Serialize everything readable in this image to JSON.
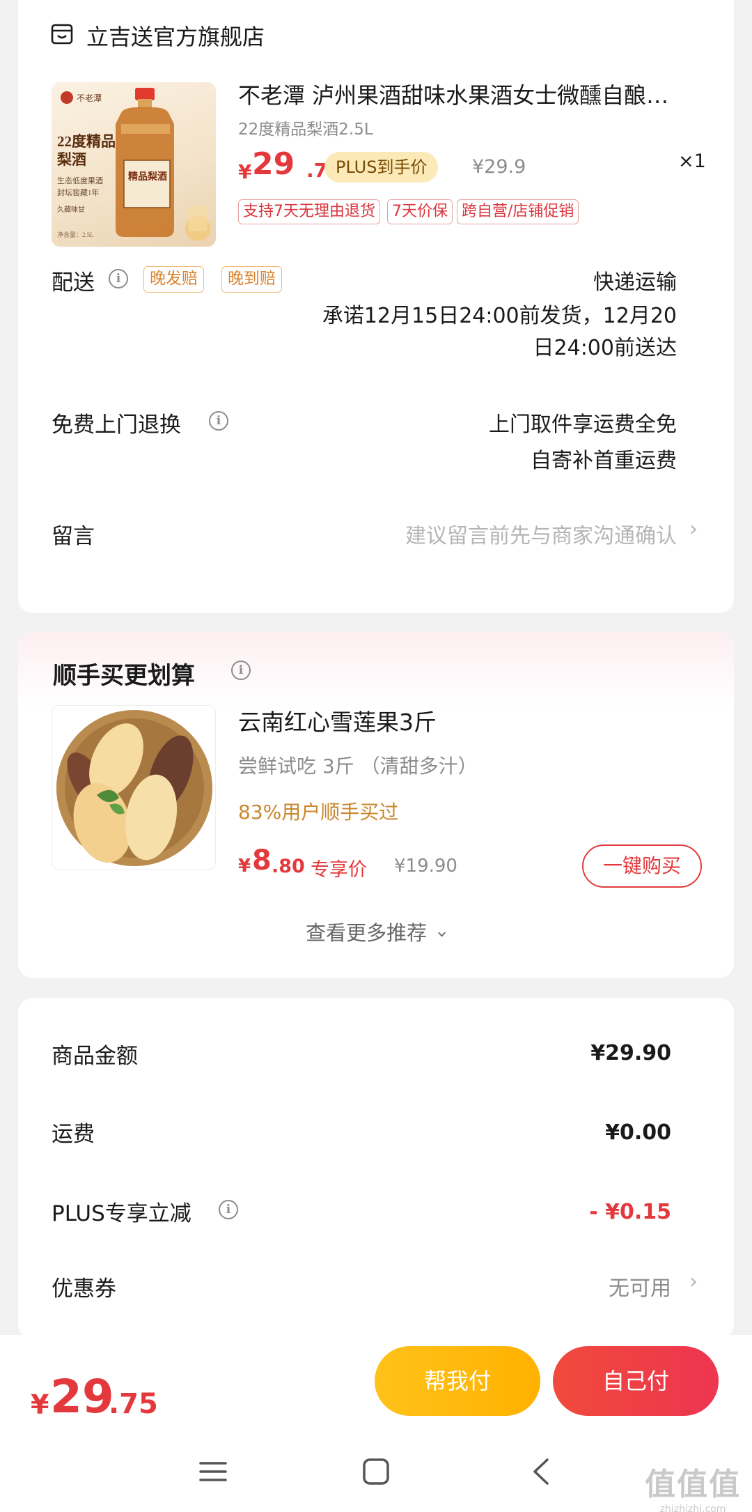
{
  "store": {
    "name": "立吉送官方旗舰店",
    "product": {
      "title": "不老潭 泸州果酒甜味水果酒女士微醺自酿…",
      "spec": "22度精品梨酒2.5L",
      "image_text": {
        "brand": "不老潭",
        "line1": "22度精品",
        "line2": "梨酒",
        "line3": "生态低度果酒",
        "line4": "封坛窖藏1年",
        "line5": "久藏味甘",
        "line6": "净含量：2.5L",
        "bottle_label": "精品梨酒"
      },
      "price_yuan": "¥",
      "price_int": "29",
      "price_dec": ".75",
      "plus_tag": "PLUS到手价",
      "original_price": "¥29.9",
      "quantity": "×1",
      "service_tags": [
        "支持7天无理由退货",
        "7天价保",
        "跨自营/店铺促销"
      ]
    }
  },
  "delivery": {
    "label": "配送",
    "tags": [
      "晚发赔",
      "晚到赔"
    ],
    "method": "快递运输",
    "promise_line1": "承诺12月15日24:00前发货，12月20",
    "promise_line2": "日24:00前送达"
  },
  "return_service": {
    "label": "免费上门退换",
    "line1": "上门取件享运费全免",
    "line2": "自寄补首重运费"
  },
  "message": {
    "label": "留言",
    "placeholder": "建议留言前先与商家沟通确认"
  },
  "bundle": {
    "title": "顺手买更划算",
    "item": {
      "title": "云南红心雪莲果3斤",
      "subtitle": "尝鲜试吃 3斤 （清甜多汁）",
      "bought": "83%用户顺手买过",
      "price_yuan": "¥",
      "price_int": "8",
      "price_dec": ".80",
      "exclusive": "专享价",
      "original_price": "¥19.90",
      "buy_button": "一键购买"
    },
    "see_more": "查看更多推荐"
  },
  "summary": {
    "goods_label": "商品金额",
    "goods_value": "¥29.90",
    "shipping_label": "运费",
    "shipping_value": "¥0.00",
    "plus_label": "PLUS专享立减",
    "plus_value": "- ¥0.15",
    "coupon_label": "优惠券",
    "coupon_value": "无可用"
  },
  "bottom": {
    "total_yuan": "¥",
    "total_int": "29",
    "total_dec": ".75",
    "help_pay": "帮我付",
    "self_pay": "自己付"
  },
  "watermark": {
    "text": "值值值",
    "url": "zhizhizhi.com"
  },
  "colors": {
    "accent_red": "#e4393c",
    "plus_gold": "#fce9b8",
    "help_yellow": "#ffb100",
    "tag_orange": "#d9822b"
  }
}
